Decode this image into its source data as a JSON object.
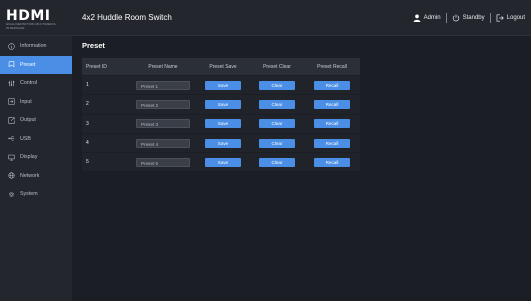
{
  "header": {
    "logo_text": "HDMI",
    "logo_tagline": "HIGH-DEFINITION MULTIMEDIA INTERFACE",
    "title": "4x2 Huddle Room Switch",
    "user_label": "Admin",
    "standby_label": "Standby",
    "logout_label": "Logout"
  },
  "sidebar": {
    "items": [
      {
        "label": "Information",
        "icon": "info-icon",
        "active": false
      },
      {
        "label": "Preset",
        "icon": "bookmark-icon",
        "active": true
      },
      {
        "label": "Control",
        "icon": "sliders-icon",
        "active": false
      },
      {
        "label": "Input",
        "icon": "input-icon",
        "active": false
      },
      {
        "label": "Output",
        "icon": "output-icon",
        "active": false
      },
      {
        "label": "USB",
        "icon": "usb-icon",
        "active": false
      },
      {
        "label": "Display",
        "icon": "monitor-icon",
        "active": false
      },
      {
        "label": "Network",
        "icon": "globe-icon",
        "active": false
      },
      {
        "label": "System",
        "icon": "gear-icon",
        "active": false
      }
    ]
  },
  "main": {
    "title": "Preset",
    "columns": [
      "Preset ID",
      "Preset Name",
      "Preset Save",
      "Preset Clear",
      "Preset Recall"
    ],
    "rows": [
      {
        "id": "1",
        "name": "Preset 1",
        "save": "Save",
        "clear": "Clear",
        "recall": "Recall"
      },
      {
        "id": "2",
        "name": "Preset 2",
        "save": "Save",
        "clear": "Clear",
        "recall": "Recall"
      },
      {
        "id": "3",
        "name": "Preset 3",
        "save": "Save",
        "clear": "Clear",
        "recall": "Recall"
      },
      {
        "id": "4",
        "name": "Preset 4",
        "save": "Save",
        "clear": "Clear",
        "recall": "Recall"
      },
      {
        "id": "5",
        "name": "Preset 5",
        "save": "Save",
        "clear": "Clear",
        "recall": "Recall"
      }
    ]
  },
  "colors": {
    "accent": "#4a8ee6",
    "background": "#1b1e24",
    "panel": "#23262d"
  }
}
